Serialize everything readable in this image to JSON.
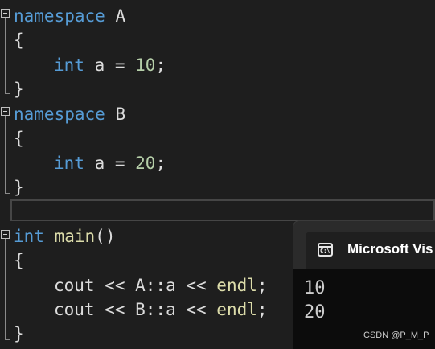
{
  "editor": {
    "lines": [
      {
        "t1": "namespace",
        "t2": " A"
      },
      {
        "t1": "{"
      },
      {
        "t1": "int",
        "t2": " a = ",
        "t3": "10",
        "t4": ";"
      },
      {
        "t1": "}"
      },
      {
        "t1": "namespace",
        "t2": " B"
      },
      {
        "t1": "{"
      },
      {
        "t1": "int",
        "t2": " a = ",
        "t3": "20",
        "t4": ";"
      },
      {
        "t1": "}"
      },
      {
        "t1": "int",
        "t2": " ",
        "t3": "main",
        "t4": "()"
      },
      {
        "t1": "{"
      },
      {
        "t1": "cout << A::a << ",
        "t2": "endl",
        "t3": ";"
      },
      {
        "t1": "cout << B::a << ",
        "t2": "endl",
        "t3": ";"
      },
      {
        "t1": "}"
      }
    ]
  },
  "console": {
    "icon_name": "console-app-icon",
    "icon_text": "C:\\",
    "title": "Microsoft Vis",
    "output": [
      "10",
      "20"
    ]
  },
  "watermark": "CSDN @P_M_P",
  "colors": {
    "background": "#1e1e1e",
    "keyword": "#569cd6",
    "number": "#b5cea8",
    "function": "#dcdcaa",
    "text": "#dcdcdc",
    "console_bg": "#0c0c0c"
  }
}
